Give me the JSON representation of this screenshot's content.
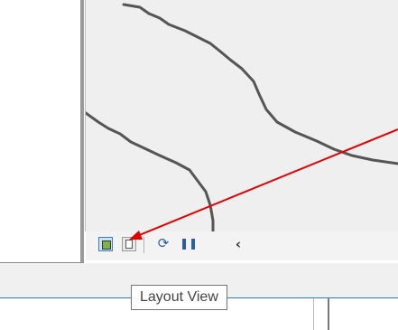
{
  "map": {
    "features": [
      "boundary-line-upper",
      "boundary-line-lower"
    ],
    "colors": {
      "canvas": "#efefef",
      "line": "#555555"
    }
  },
  "toolbar": {
    "buttons": [
      {
        "id": "data-view",
        "icon": "data-view-icon",
        "state": "active"
      },
      {
        "id": "layout-view",
        "icon": "layout-view-icon",
        "state": "hovered"
      },
      {
        "id": "refresh",
        "icon": "refresh-icon",
        "glyph": "⟳"
      },
      {
        "id": "pause",
        "icon": "pause-icon",
        "glyph": "❚❚"
      },
      {
        "id": "collapse",
        "icon": "chevron-left-icon",
        "glyph": "‹"
      }
    ]
  },
  "tooltip": {
    "text": "Layout View"
  },
  "annotation": {
    "arrow_color": "#e10000",
    "points_to": "layout-view-button"
  }
}
